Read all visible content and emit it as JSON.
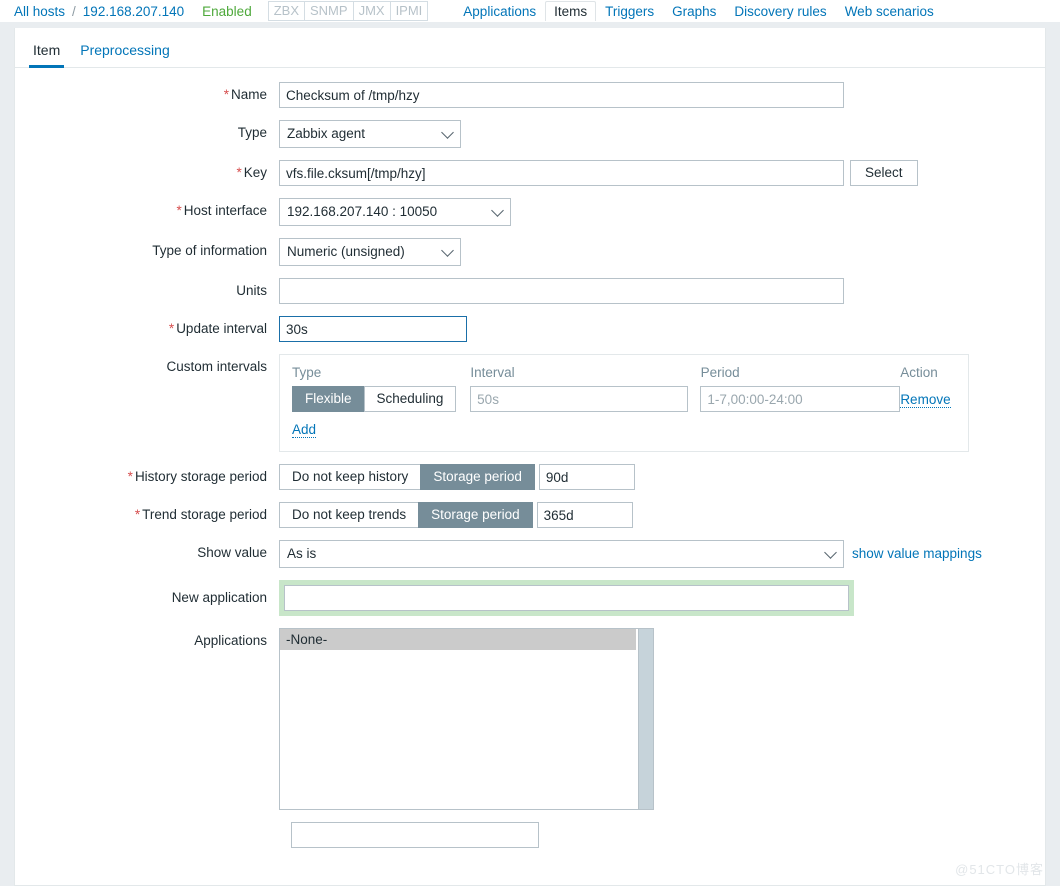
{
  "hostnav": {
    "all_hosts": "All hosts",
    "separator": "/",
    "host": "192.168.207.140",
    "status": "Enabled",
    "interface_tags": [
      "ZBX",
      "SNMP",
      "JMX",
      "IPMI"
    ],
    "links": [
      {
        "label": "Applications",
        "current": false
      },
      {
        "label": "Items",
        "current": true
      },
      {
        "label": "Triggers",
        "current": false
      },
      {
        "label": "Graphs",
        "current": false
      },
      {
        "label": "Discovery rules",
        "current": false
      },
      {
        "label": "Web scenarios",
        "current": false
      }
    ]
  },
  "tabs": [
    {
      "label": "Item",
      "active": true
    },
    {
      "label": "Preprocessing",
      "active": false
    }
  ],
  "form": {
    "name": {
      "label": "Name",
      "required": true,
      "value": "Checksum of /tmp/hzy",
      "placeholder": ""
    },
    "type": {
      "label": "Type",
      "required": false,
      "value": "Zabbix agent"
    },
    "key": {
      "label": "Key",
      "required": true,
      "value": "vfs.file.cksum[/tmp/hzy]",
      "placeholder": "",
      "select_button": "Select"
    },
    "host_interface": {
      "label": "Host interface",
      "required": true,
      "value": "192.168.207.140 : 10050"
    },
    "type_of_information": {
      "label": "Type of information",
      "required": false,
      "value": "Numeric (unsigned)"
    },
    "units": {
      "label": "Units",
      "required": false,
      "value": "",
      "placeholder": ""
    },
    "update_interval": {
      "label": "Update interval",
      "required": true,
      "value": "30s",
      "placeholder": "",
      "focused": true
    },
    "custom_intervals": {
      "label": "Custom intervals",
      "columns": [
        "Type",
        "Interval",
        "Period",
        "Action"
      ],
      "rows": [
        {
          "type_options": [
            "Flexible",
            "Scheduling"
          ],
          "type_selected": "Flexible",
          "interval_value": "",
          "interval_placeholder": "50s",
          "period_value": "",
          "period_placeholder": "1-7,00:00-24:00",
          "action": "Remove"
        }
      ],
      "add_label": "Add"
    },
    "history_storage_period": {
      "label": "History storage period",
      "required": true,
      "options": [
        "Do not keep history",
        "Storage period"
      ],
      "selected": "Storage period",
      "value": "90d"
    },
    "trend_storage_period": {
      "label": "Trend storage period",
      "required": true,
      "options": [
        "Do not keep trends",
        "Storage period"
      ],
      "selected": "Storage period",
      "value": "365d"
    },
    "show_value": {
      "label": "Show value",
      "required": false,
      "value": "As is",
      "side_link": "show value mappings"
    },
    "new_application": {
      "label": "New application",
      "required": false,
      "value": "",
      "placeholder": "",
      "highlighted": true
    },
    "applications": {
      "label": "Applications",
      "options": [
        "-None-"
      ],
      "selected": "-None-"
    }
  },
  "colors": {
    "link": "#0275b8",
    "enabled_green": "#4ea93b",
    "required_red": "#d64e4e",
    "segment_selected": "#768d99",
    "highlight_green": "#c8e6c9",
    "focus_border": "#1a6fa8",
    "page_background": "#e9edf0"
  },
  "watermark": "@51CTO博客"
}
